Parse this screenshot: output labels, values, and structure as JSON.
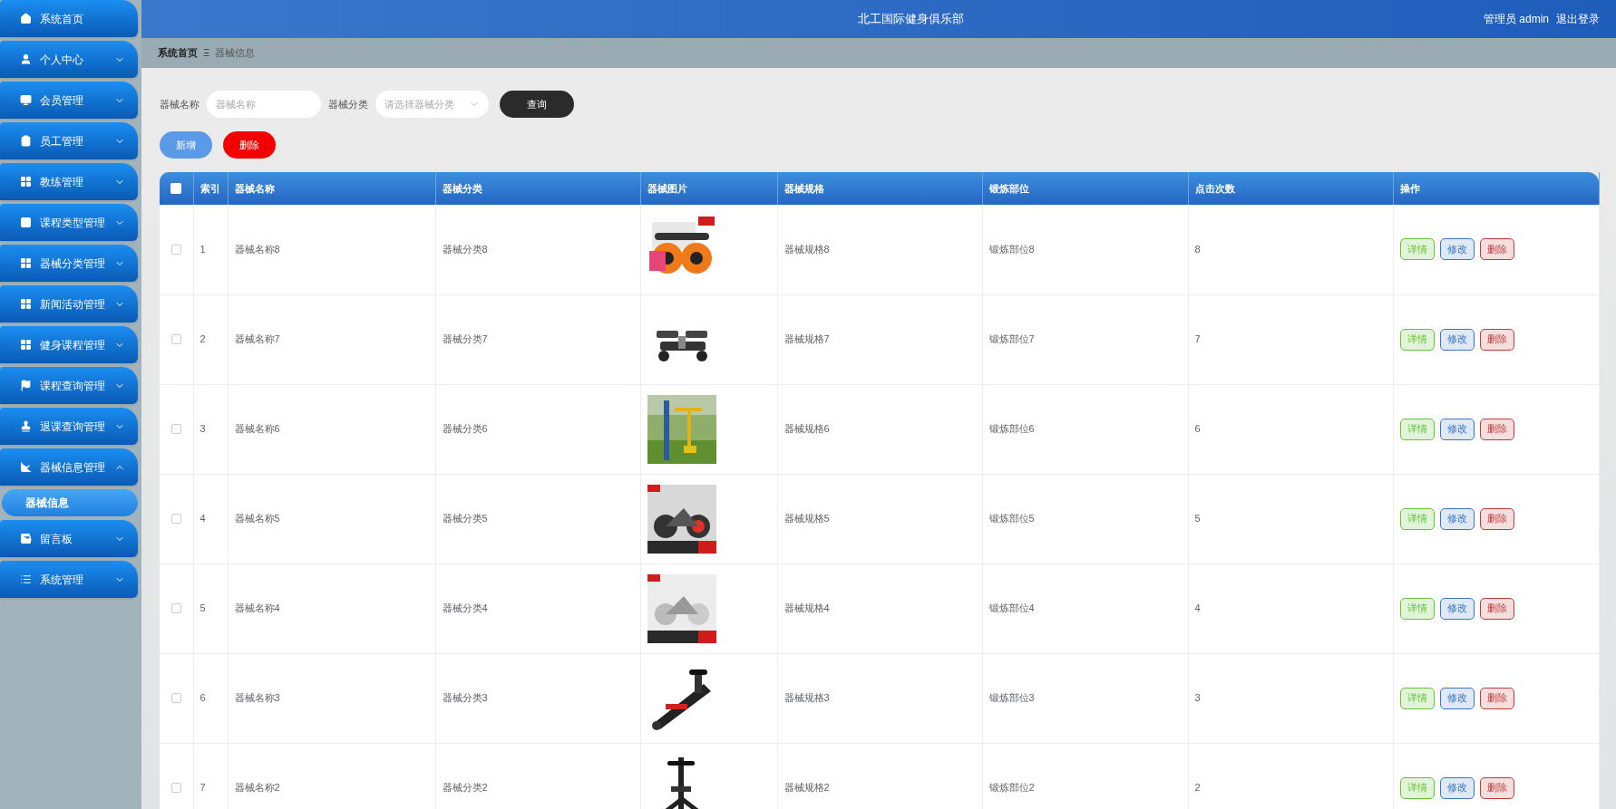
{
  "sidebar": {
    "items": [
      {
        "label": "系统首页",
        "kind": "link"
      },
      {
        "label": "个人中心",
        "kind": "menu",
        "expanded": false
      },
      {
        "label": "会员管理",
        "kind": "menu",
        "expanded": false
      },
      {
        "label": "员工管理",
        "kind": "menu",
        "expanded": false
      },
      {
        "label": "教练管理",
        "kind": "menu",
        "expanded": false
      },
      {
        "label": "课程类型管理",
        "kind": "menu",
        "expanded": false
      },
      {
        "label": "器械分类管理",
        "kind": "menu",
        "expanded": false
      },
      {
        "label": "新闻活动管理",
        "kind": "menu",
        "expanded": false
      },
      {
        "label": "健身课程管理",
        "kind": "menu",
        "expanded": false
      },
      {
        "label": "课程查询管理",
        "kind": "menu",
        "expanded": false
      },
      {
        "label": "退课查询管理",
        "kind": "menu",
        "expanded": false
      },
      {
        "label": "器械信息管理",
        "kind": "menu",
        "expanded": true,
        "children": [
          {
            "label": "器械信息",
            "selected": true
          }
        ]
      },
      {
        "label": "留言板",
        "kind": "menu",
        "expanded": false
      },
      {
        "label": "系统管理",
        "kind": "menu",
        "expanded": false
      }
    ]
  },
  "header": {
    "title": "北工国际健身俱乐部",
    "user": "管理员 admin",
    "logout": "退出登录"
  },
  "breadcrumb": {
    "items": [
      "系统首页",
      "器械信息"
    ],
    "separator": "Ξ"
  },
  "search": {
    "fields": [
      {
        "label": "器械名称",
        "placeholder": "器械名称",
        "kind": "text"
      },
      {
        "label": "器械分类",
        "placeholder": "请选择器械分类",
        "kind": "select"
      }
    ],
    "button": "查询"
  },
  "toolbar": [
    {
      "label": "新增",
      "kind": "add"
    },
    {
      "label": "删除",
      "kind": "delete"
    }
  ],
  "table": {
    "select_all": {
      "checked": false
    },
    "columns": [
      "索引",
      "器械名称",
      "器械分类",
      "器械图片",
      "器械规格",
      "锻炼部位",
      "点击次数",
      "操作"
    ],
    "rows": [
      {
        "checked": false,
        "index": "1",
        "name": "器械名称8",
        "category": "器械分类8",
        "spec": "器械规格8",
        "part": "锻炼部位8",
        "clicks": "8",
        "actions": [
          {
            "label": "详情",
            "kind": "detail"
          },
          {
            "label": "修改",
            "kind": "edit"
          },
          {
            "label": "删除",
            "kind": "delete"
          }
        ]
      },
      {
        "checked": false,
        "index": "2",
        "name": "器械名称7",
        "category": "器械分类7",
        "spec": "器械规格7",
        "part": "锻炼部位7",
        "clicks": "7",
        "actions": [
          {
            "label": "详情",
            "kind": "detail"
          },
          {
            "label": "修改",
            "kind": "edit"
          },
          {
            "label": "删除",
            "kind": "delete"
          }
        ]
      },
      {
        "checked": false,
        "index": "3",
        "name": "器械名称6",
        "category": "器械分类6",
        "spec": "器械规格6",
        "part": "锻炼部位6",
        "clicks": "6",
        "actions": [
          {
            "label": "详情",
            "kind": "detail"
          },
          {
            "label": "修改",
            "kind": "edit"
          },
          {
            "label": "删除",
            "kind": "delete"
          }
        ]
      },
      {
        "checked": false,
        "index": "4",
        "name": "器械名称5",
        "category": "器械分类5",
        "spec": "器械规格5",
        "part": "锻炼部位5",
        "clicks": "5",
        "actions": [
          {
            "label": "详情",
            "kind": "detail"
          },
          {
            "label": "修改",
            "kind": "edit"
          },
          {
            "label": "删除",
            "kind": "delete"
          }
        ]
      },
      {
        "checked": false,
        "index": "5",
        "name": "器械名称4",
        "category": "器械分类4",
        "spec": "器械规格4",
        "part": "锻炼部位4",
        "clicks": "4",
        "actions": [
          {
            "label": "详情",
            "kind": "detail"
          },
          {
            "label": "修改",
            "kind": "edit"
          },
          {
            "label": "删除",
            "kind": "delete"
          }
        ]
      },
      {
        "checked": false,
        "index": "6",
        "name": "器械名称3",
        "category": "器械分类3",
        "spec": "器械规格3",
        "part": "锻炼部位3",
        "clicks": "3",
        "actions": [
          {
            "label": "详情",
            "kind": "detail"
          },
          {
            "label": "修改",
            "kind": "edit"
          },
          {
            "label": "删除",
            "kind": "delete"
          }
        ]
      },
      {
        "checked": false,
        "index": "7",
        "name": "器械名称2",
        "category": "器械分类2",
        "spec": "器械规格2",
        "part": "锻炼部位2",
        "clicks": "2",
        "actions": [
          {
            "label": "详情",
            "kind": "detail"
          },
          {
            "label": "修改",
            "kind": "edit"
          },
          {
            "label": "删除",
            "kind": "delete"
          }
        ]
      }
    ]
  }
}
